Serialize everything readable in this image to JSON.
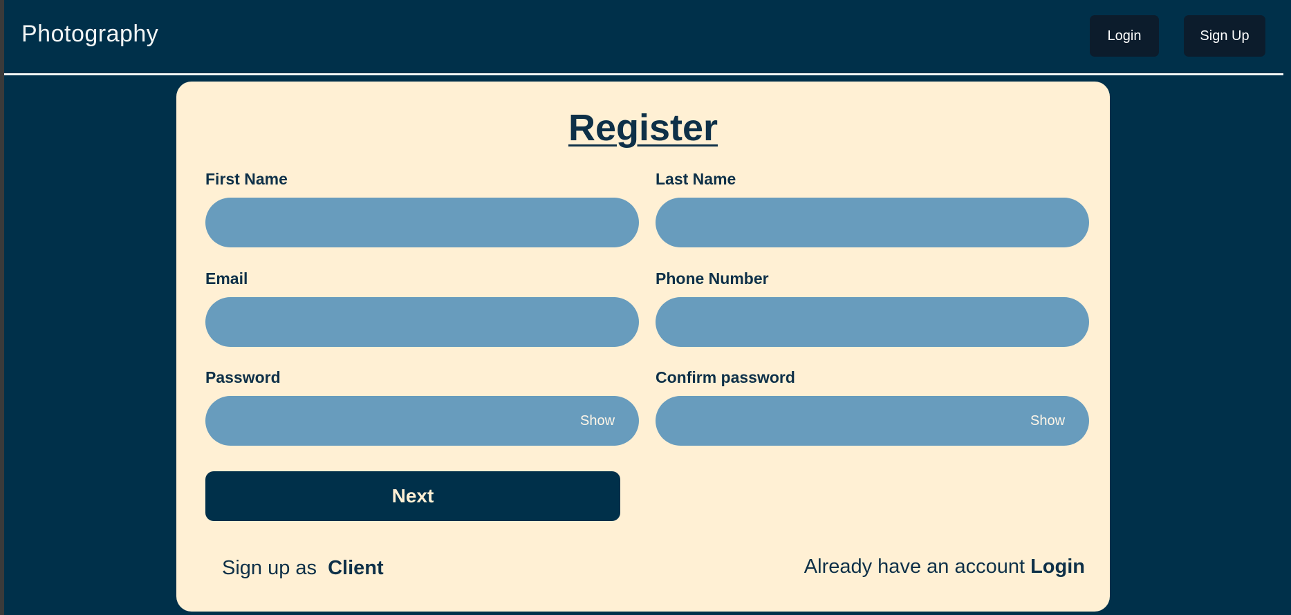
{
  "header": {
    "brand": "Photography",
    "login_label": "Login",
    "signup_label": "Sign Up"
  },
  "form": {
    "title": "Register",
    "fields": {
      "first_name": {
        "label": "First Name",
        "value": ""
      },
      "last_name": {
        "label": "Last Name",
        "value": ""
      },
      "email": {
        "label": "Email",
        "value": ""
      },
      "phone": {
        "label": "Phone Number",
        "value": ""
      },
      "password": {
        "label": "Password",
        "value": "",
        "toggle": "Show"
      },
      "confirm_password": {
        "label": "Confirm password",
        "value": "",
        "toggle": "Show"
      }
    },
    "next_label": "Next",
    "signup_as_text": "Sign up as",
    "signup_role": "Client",
    "have_account_text": "Already have an account",
    "login_link": "Login"
  },
  "colors": {
    "page_background": "#00304a",
    "card_background": "#fff0d4",
    "input_background": "#689cbd",
    "nav_button": "#0c1c2c",
    "text_dark": "#0e3048"
  }
}
